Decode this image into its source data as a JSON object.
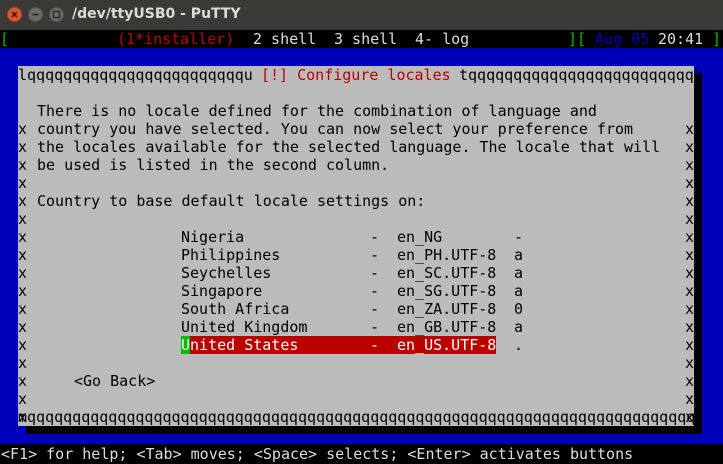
{
  "window": {
    "title": "/dev/ttyUSB0 - PuTTY"
  },
  "status": {
    "left_bracket": "[",
    "windows": [
      {
        "label": "(1*installer)"
      },
      {
        "label": "2 shell"
      },
      {
        "label": "3 shell"
      },
      {
        "label": "4- log"
      }
    ],
    "right_bracket": "][",
    "date": "Aug 05",
    "time": "20:41",
    "end_bracket": "]"
  },
  "dialog": {
    "title": "[!] Configure locales",
    "top_left_border": "lqqqqqqqqqqqqqqqqqqqqqqqqu",
    "top_right_border": "tqqqqqqqqqqqqqqqqqqqqqqqqqk",
    "bottom_border": "mqqqqqqqqqqqqqqqqqqqqqqqqqqqqqqqqqqqqqqqqqqqqqqqqqqqqqqqqqqqqqqqqqqqqqqqqqqj",
    "description": [
      "There is no locale defined for the combination of language and",
      "country you have selected. You can now select your preference from",
      "the locales available for the selected language. The locale that will",
      "be used is listed in the second column."
    ],
    "prompt": "Country to base default locale settings on:",
    "locales": [
      {
        "country": "Nigeria",
        "dash": "-",
        "locale": "en_NG",
        "marker": "-"
      },
      {
        "country": "Philippines",
        "dash": "-",
        "locale": "en_PH.UTF-8",
        "marker": "a"
      },
      {
        "country": "Seychelles",
        "dash": "-",
        "locale": "en_SC.UTF-8",
        "marker": "a"
      },
      {
        "country": "Singapore",
        "dash": "-",
        "locale": "en_SG.UTF-8",
        "marker": "a"
      },
      {
        "country": "South Africa",
        "dash": "-",
        "locale": "en_ZA.UTF-8",
        "marker": "0"
      },
      {
        "country": "United Kingdom",
        "dash": "-",
        "locale": "en_GB.UTF-8",
        "marker": "a"
      },
      {
        "country": "United States",
        "dash": "-",
        "locale": "en_US.UTF-8",
        "marker": "."
      }
    ],
    "selected_index": 6,
    "go_back_label": "<Go Back>",
    "side_char": "x"
  },
  "help_line": "<F1> for help; <Tab> moves; <Space> selects; <Enter> activates buttons",
  "colors": {
    "background": "#0000bb",
    "dialog": "#bbbbbb",
    "highlight": "#bb0000",
    "cursor": "#00bb00",
    "status_green": "#00bb00",
    "status_date": "#0000bb"
  }
}
